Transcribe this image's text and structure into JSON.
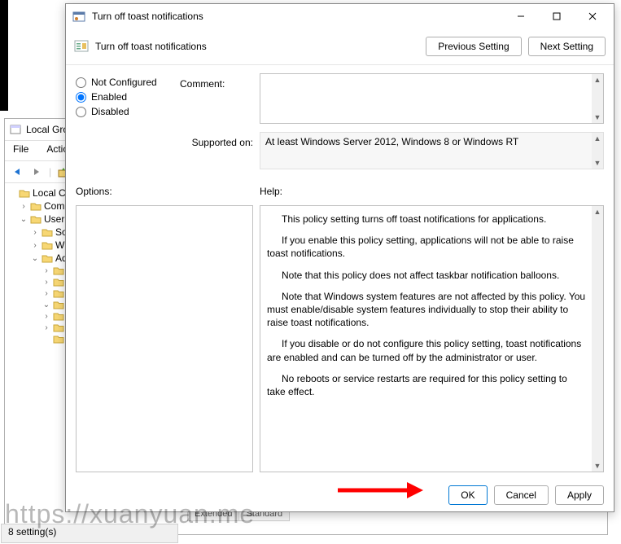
{
  "bg_window": {
    "title": "Local Gro",
    "menu": [
      "File",
      "Action"
    ],
    "tree": [
      {
        "label": "Local Con",
        "icon": "policy",
        "exp": ""
      },
      {
        "label": "Comp",
        "icon": "folder-cog",
        "exp": "›",
        "indent": 1
      },
      {
        "label": "User C",
        "icon": "folder-user",
        "exp": "⌄",
        "indent": 1
      },
      {
        "label": "So",
        "icon": "folder",
        "exp": "›",
        "indent": 2
      },
      {
        "label": "Wi",
        "icon": "folder",
        "exp": "›",
        "indent": 2
      },
      {
        "label": "Ad",
        "icon": "folder",
        "exp": "⌄",
        "indent": 2
      },
      {
        "label": "",
        "icon": "folder",
        "exp": "›",
        "indent": 3
      },
      {
        "label": "",
        "icon": "folder",
        "exp": "›",
        "indent": 3
      },
      {
        "label": "",
        "icon": "folder",
        "exp": "›",
        "indent": 3
      },
      {
        "label": "",
        "icon": "folder",
        "exp": "⌄",
        "indent": 3
      },
      {
        "label": "",
        "icon": "folder",
        "exp": "›",
        "indent": 3
      },
      {
        "label": "",
        "icon": "folder",
        "exp": "›",
        "indent": 3
      },
      {
        "label": "",
        "icon": "folder-set",
        "exp": "",
        "indent": 3
      }
    ],
    "tabs": [
      "Extended",
      "Standard"
    ],
    "status": "8 setting(s)"
  },
  "dialog": {
    "title": "Turn off toast notifications",
    "header_title": "Turn off toast notifications",
    "prev_btn": "Previous Setting",
    "next_btn": "Next Setting",
    "radios": {
      "not_configured": "Not Configured",
      "enabled": "Enabled",
      "disabled": "Disabled",
      "selected": "enabled"
    },
    "comment_label": "Comment:",
    "supported_label": "Supported on:",
    "supported_value": "At least Windows Server 2012, Windows 8 or Windows RT",
    "options_label": "Options:",
    "help_label": "Help:",
    "help_paragraphs": [
      "This policy setting turns off toast notifications for applications.",
      "If you enable this policy setting, applications will not be able to raise toast notifications.",
      "Note that this policy does not affect taskbar notification balloons.",
      "Note that Windows system features are not affected by this policy.  You must enable/disable system features individually to stop their ability to raise toast notifications.",
      "If you disable or do not configure this policy setting, toast notifications are enabled and can be turned off by the administrator or user.",
      "No reboots or service restarts are required for this policy setting to take effect."
    ],
    "ok_btn": "OK",
    "cancel_btn": "Cancel",
    "apply_btn": "Apply"
  },
  "watermark": "https://xuanyuan.me"
}
